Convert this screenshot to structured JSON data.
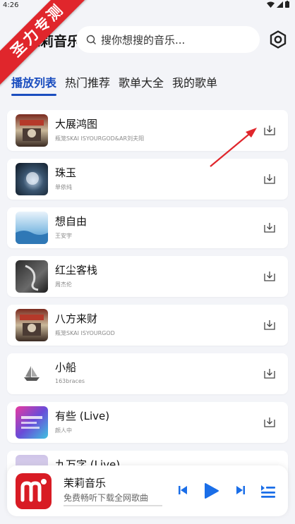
{
  "status_bar": {
    "time": "4:26"
  },
  "watermark": {
    "text": "圣力专测"
  },
  "header": {
    "app_title": "茉莉音乐",
    "search_placeholder": "搜你想搜的音乐...",
    "settings_icon": "gear-icon"
  },
  "tabs": [
    {
      "label": "播放列表",
      "active": true
    },
    {
      "label": "热门推荐",
      "active": false
    },
    {
      "label": "歌单大全",
      "active": false
    },
    {
      "label": "我的歌单",
      "active": false
    }
  ],
  "songs": [
    {
      "title": "大展鸿图",
      "artist": "瓶笼SKAI ISYOURGOD&AR刘夫阳"
    },
    {
      "title": "珠玉",
      "artist": "单依纯"
    },
    {
      "title": "想自由",
      "artist": "王安宇"
    },
    {
      "title": "红尘客栈",
      "artist": "周杰伦"
    },
    {
      "title": "八方来财",
      "artist": "瓶笼SKAI ISYOURGOD"
    },
    {
      "title": "小船",
      "artist": "163braces"
    },
    {
      "title": "有些 (Live)",
      "artist": "颜人中"
    },
    {
      "title": "九万字 (Live)",
      "artist": ""
    }
  ],
  "player": {
    "title": "茉莉音乐",
    "subtitle": "免费畅听下载全网歌曲",
    "accent": "#1a6ee8",
    "logo_color": "#d81b24"
  },
  "colors": {
    "tab_active": "#1a4dbf",
    "ribbon": "#e0262c"
  }
}
